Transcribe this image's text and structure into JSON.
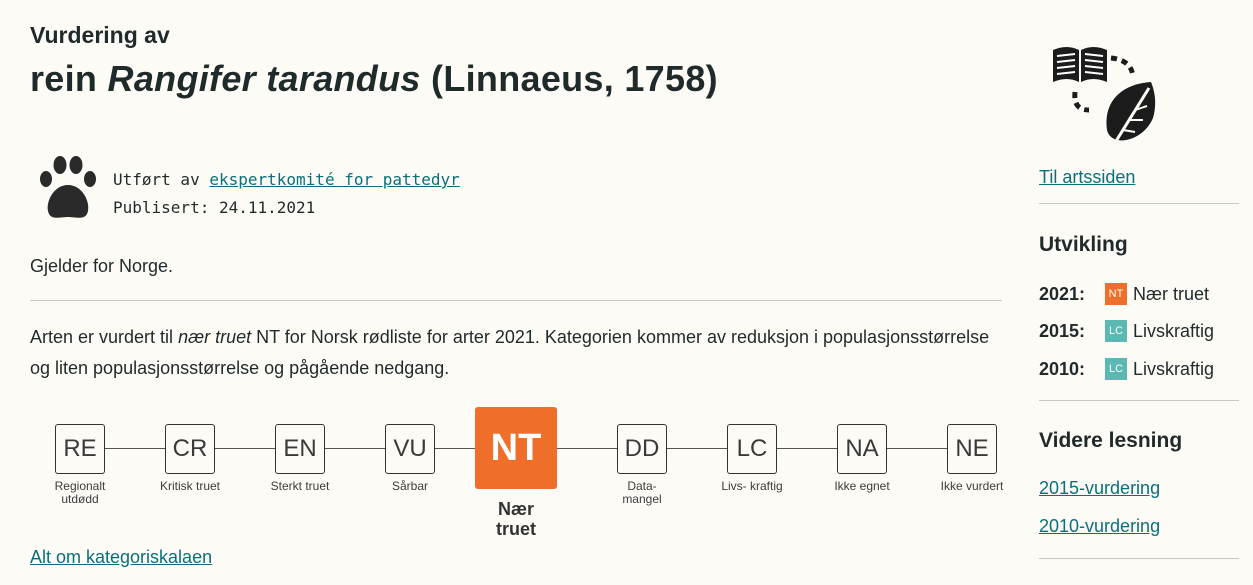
{
  "header": {
    "pre_title": "Vurdering av",
    "common_name": "rein",
    "scientific_name": "Rangifer tarandus",
    "author": "(Linnaeus, 1758)"
  },
  "meta": {
    "done_by_label": "Utført av",
    "committee_link": "ekspertkomité for pattedyr",
    "published_label": "Publisert:",
    "published_date": "24.11.2021"
  },
  "region": "Gjelder for Norge.",
  "summary": {
    "part1": "Arten er vurdert til",
    "category_name": "nær truet",
    "part2": "NT for Norsk rødliste for arter 2021. Kategorien kommer av reduksjon i populasjonsstørrelse og liten populasjonsstørrelse og pågående nedgang."
  },
  "scale": {
    "categories": [
      {
        "code": "RE",
        "label": "Regionalt utdødd"
      },
      {
        "code": "CR",
        "label": "Kritisk truet"
      },
      {
        "code": "EN",
        "label": "Sterkt truet"
      },
      {
        "code": "VU",
        "label": "Sårbar"
      },
      {
        "code": "NT",
        "label": "Nær truet",
        "active": true
      },
      {
        "code": "DD",
        "label": "Data- mangel"
      },
      {
        "code": "LC",
        "label": "Livs- kraftig"
      },
      {
        "code": "NA",
        "label": "Ikke egnet"
      },
      {
        "code": "NE",
        "label": "Ikke vurdert"
      }
    ],
    "link": "Alt om kategoriskalaen"
  },
  "sidebar": {
    "species_link": "Til artssiden",
    "development_title": "Utvikling",
    "history": [
      {
        "year": "2021:",
        "code": "NT",
        "label": "Nær truet",
        "color": "#ee6e2a"
      },
      {
        "year": "2015:",
        "code": "LC",
        "label": "Livskraftig",
        "color": "#5cb8b2"
      },
      {
        "year": "2010:",
        "code": "LC",
        "label": "Livskraftig",
        "color": "#5cb8b2"
      }
    ],
    "further_title": "Videre lesning",
    "links": [
      "2015-vurdering",
      "2010-vurdering"
    ]
  },
  "colors": {
    "accent": "#ee6e2a",
    "lc": "#5cb8b2",
    "link": "#0a6f7c",
    "background": "#fdfbf6"
  }
}
